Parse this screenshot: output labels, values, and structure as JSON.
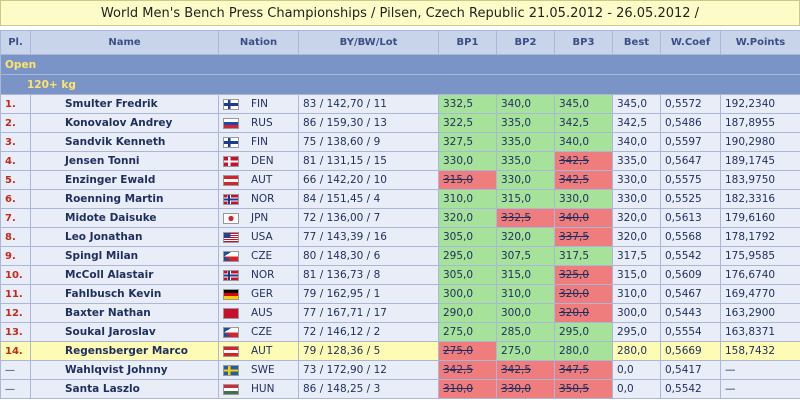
{
  "title": "World Men's Bench Press Championships / Pilsen, Czech Republic 21.05.2012 - 26.05.2012 /",
  "headers": {
    "pl": "Pl.",
    "name": "Name",
    "nation": "Nation",
    "bw": "BY/BW/Lot",
    "bp1": "BP1",
    "bp2": "BP2",
    "bp3": "BP3",
    "best": "Best",
    "wcoef": "W.Coef",
    "wpoints": "W.Points"
  },
  "section_open": "Open",
  "section_weight": "120+ kg",
  "rows": [
    {
      "pl": "1.",
      "name": "Smulter Fredrik",
      "nation": "FIN",
      "flag": "fin",
      "by": "83",
      "bw": "142,70",
      "lot": "11",
      "bp": [
        [
          "332,5",
          "good"
        ],
        [
          "340,0",
          "good"
        ],
        [
          "345,0",
          "good"
        ]
      ],
      "best": "345,0",
      "wcoef": "0,5572",
      "wpoints": "192,2340",
      "hl": false
    },
    {
      "pl": "2.",
      "name": "Konovalov Andrey",
      "nation": "RUS",
      "flag": "rus",
      "by": "86",
      "bw": "159,30",
      "lot": "13",
      "bp": [
        [
          "322,5",
          "good"
        ],
        [
          "335,0",
          "good"
        ],
        [
          "342,5",
          "good"
        ]
      ],
      "best": "342,5",
      "wcoef": "0,5486",
      "wpoints": "187,8955",
      "hl": false
    },
    {
      "pl": "3.",
      "name": "Sandvik Kenneth",
      "nation": "FIN",
      "flag": "fin",
      "by": "75",
      "bw": "138,60",
      "lot": "9",
      "bp": [
        [
          "327,5",
          "good"
        ],
        [
          "335,0",
          "good"
        ],
        [
          "340,0",
          "good"
        ]
      ],
      "best": "340,0",
      "wcoef": "0,5597",
      "wpoints": "190,2980",
      "hl": false
    },
    {
      "pl": "4.",
      "name": "Jensen Tonni",
      "nation": "DEN",
      "flag": "den",
      "by": "81",
      "bw": "131,15",
      "lot": "15",
      "bp": [
        [
          "330,0",
          "good"
        ],
        [
          "335,0",
          "good"
        ],
        [
          "342,5",
          "bad"
        ]
      ],
      "best": "335,0",
      "wcoef": "0,5647",
      "wpoints": "189,1745",
      "hl": false
    },
    {
      "pl": "5.",
      "name": "Enzinger Ewald",
      "nation": "AUT",
      "flag": "aut",
      "by": "66",
      "bw": "142,20",
      "lot": "10",
      "bp": [
        [
          "315,0",
          "bad"
        ],
        [
          "330,0",
          "good"
        ],
        [
          "342,5",
          "bad"
        ]
      ],
      "best": "330,0",
      "wcoef": "0,5575",
      "wpoints": "183,9750",
      "hl": false
    },
    {
      "pl": "6.",
      "name": "Roenning Martin",
      "nation": "NOR",
      "flag": "nor",
      "by": "84",
      "bw": "151,45",
      "lot": "4",
      "bp": [
        [
          "310,0",
          "good"
        ],
        [
          "315,0",
          "good"
        ],
        [
          "330,0",
          "good"
        ]
      ],
      "best": "330,0",
      "wcoef": "0,5525",
      "wpoints": "182,3316",
      "hl": false
    },
    {
      "pl": "7.",
      "name": "Midote Daisuke",
      "nation": "JPN",
      "flag": "jpn",
      "by": "72",
      "bw": "136,00",
      "lot": "7",
      "bp": [
        [
          "320,0",
          "good"
        ],
        [
          "332,5",
          "bad"
        ],
        [
          "340,0",
          "bad"
        ]
      ],
      "best": "320,0",
      "wcoef": "0,5613",
      "wpoints": "179,6160",
      "hl": false
    },
    {
      "pl": "8.",
      "name": "Leo Jonathan",
      "nation": "USA",
      "flag": "usa",
      "by": "77",
      "bw": "143,39",
      "lot": "16",
      "bp": [
        [
          "305,0",
          "good"
        ],
        [
          "320,0",
          "good"
        ],
        [
          "337,5",
          "bad"
        ]
      ],
      "best": "320,0",
      "wcoef": "0,5568",
      "wpoints": "178,1792",
      "hl": false
    },
    {
      "pl": "9.",
      "name": "Spingl Milan",
      "nation": "CZE",
      "flag": "cze",
      "by": "80",
      "bw": "148,30",
      "lot": "6",
      "bp": [
        [
          "295,0",
          "good"
        ],
        [
          "307,5",
          "good"
        ],
        [
          "317,5",
          "good"
        ]
      ],
      "best": "317,5",
      "wcoef": "0,5542",
      "wpoints": "175,9585",
      "hl": false
    },
    {
      "pl": "10.",
      "name": "McColl Alastair",
      "nation": "NOR",
      "flag": "nor",
      "by": "81",
      "bw": "136,73",
      "lot": "8",
      "bp": [
        [
          "305,0",
          "good"
        ],
        [
          "315,0",
          "good"
        ],
        [
          "325,0",
          "bad"
        ]
      ],
      "best": "315,0",
      "wcoef": "0,5609",
      "wpoints": "176,6740",
      "hl": false
    },
    {
      "pl": "11.",
      "name": "Fahlbusch Kevin",
      "nation": "GER",
      "flag": "ger",
      "by": "79",
      "bw": "162,95",
      "lot": "1",
      "bp": [
        [
          "300,0",
          "good"
        ],
        [
          "310,0",
          "good"
        ],
        [
          "320,0",
          "bad"
        ]
      ],
      "best": "310,0",
      "wcoef": "0,5467",
      "wpoints": "169,4770",
      "hl": false
    },
    {
      "pl": "12.",
      "name": "Baxter Nathan",
      "nation": "AUS",
      "flag": "aus",
      "by": "77",
      "bw": "167,71",
      "lot": "17",
      "bp": [
        [
          "290,0",
          "good"
        ],
        [
          "300,0",
          "good"
        ],
        [
          "320,0",
          "bad"
        ]
      ],
      "best": "300,0",
      "wcoef": "0,5443",
      "wpoints": "163,2900",
      "hl": false
    },
    {
      "pl": "13.",
      "name": "Soukal Jaroslav",
      "nation": "CZE",
      "flag": "cze",
      "by": "72",
      "bw": "146,12",
      "lot": "2",
      "bp": [
        [
          "275,0",
          "good"
        ],
        [
          "285,0",
          "good"
        ],
        [
          "295,0",
          "good"
        ]
      ],
      "best": "295,0",
      "wcoef": "0,5554",
      "wpoints": "163,8371",
      "hl": false
    },
    {
      "pl": "14.",
      "name": "Regensberger Marco",
      "nation": "AUT",
      "flag": "aut",
      "by": "79",
      "bw": "128,36",
      "lot": "5",
      "bp": [
        [
          "275,0",
          "bad"
        ],
        [
          "275,0",
          "good"
        ],
        [
          "280,0",
          "good"
        ]
      ],
      "best": "280,0",
      "wcoef": "0,5669",
      "wpoints": "158,7432",
      "hl": true
    },
    {
      "pl": "—",
      "name": "Wahlqvist Johnny",
      "nation": "SWE",
      "flag": "swe",
      "by": "73",
      "bw": "172,90",
      "lot": "12",
      "bp": [
        [
          "342,5",
          "bad"
        ],
        [
          "342,5",
          "bad"
        ],
        [
          "347,5",
          "bad"
        ]
      ],
      "best": "0,0",
      "wcoef": "0,5417",
      "wpoints": "—",
      "hl": false
    },
    {
      "pl": "—",
      "name": "Santa Laszlo",
      "nation": "HUN",
      "flag": "hun",
      "by": "86",
      "bw": "148,25",
      "lot": "3",
      "bp": [
        [
          "310,0",
          "bad"
        ],
        [
          "330,0",
          "bad"
        ],
        [
          "350,5",
          "bad"
        ]
      ],
      "best": "0,0",
      "wcoef": "0,5542",
      "wpoints": "—",
      "hl": false
    }
  ]
}
